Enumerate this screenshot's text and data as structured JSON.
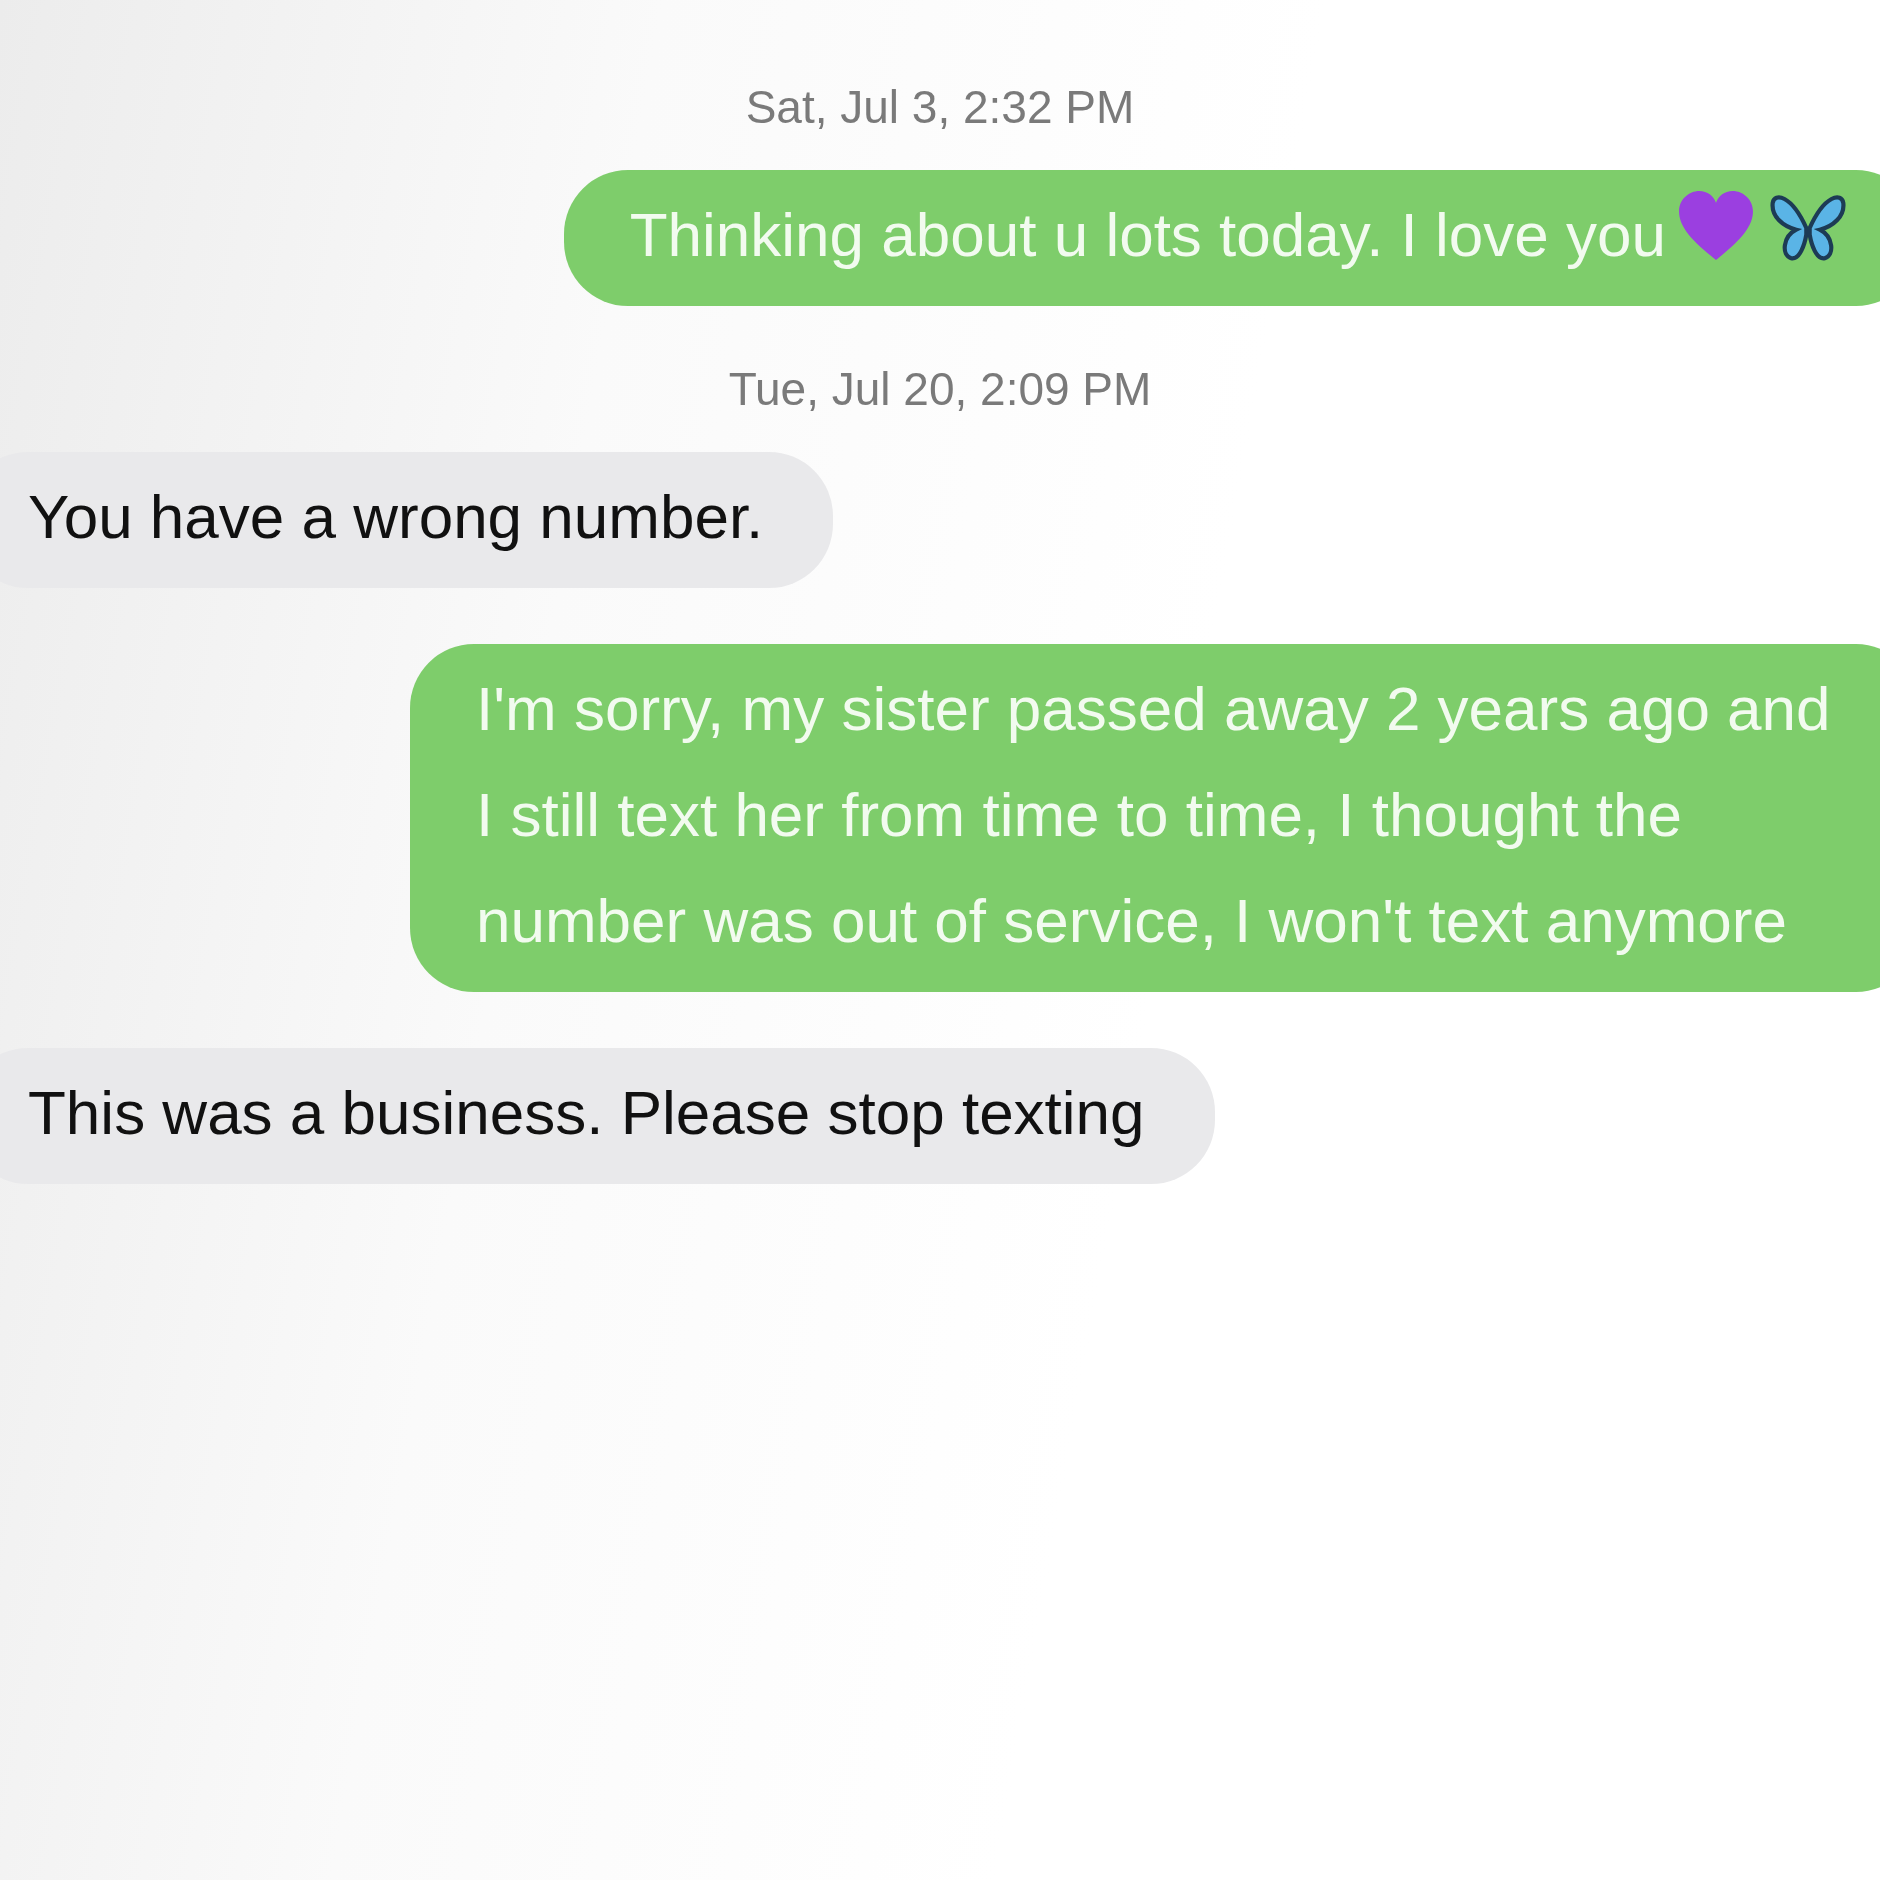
{
  "messages": [
    {
      "kind": "timestamp",
      "text": "Sat, Jul 3, 2:32 PM"
    },
    {
      "kind": "sent",
      "text": "Thinking about u lots today. I love you",
      "icons": [
        {
          "kind": "heart",
          "color": "#9b3fe0"
        },
        {
          "kind": "butterfly",
          "color": "#5ab4e6"
        }
      ]
    },
    {
      "kind": "timestamp",
      "text": "Tue, Jul 20, 2:09 PM"
    },
    {
      "kind": "received",
      "text": "You have a wrong number."
    },
    {
      "kind": "sent",
      "text": "I'm sorry, my sister passed away 2 years ago and I still text her from time to time, I thought the number was out of service, I won't text anymore"
    },
    {
      "kind": "received",
      "text": "This was a business. Please stop texting"
    }
  ]
}
